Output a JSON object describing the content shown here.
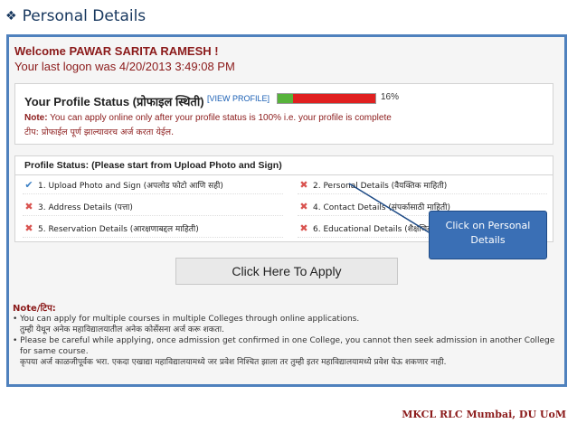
{
  "slide": {
    "title": "Personal Details",
    "bullet_icon": "diamond-bullet-icon"
  },
  "welcome": {
    "greeting": "Welcome PAWAR SARITA RAMESH !",
    "last_logon": "Your last logon was 4/20/2013 3:49:08 PM"
  },
  "profile_status": {
    "title": "Your Profile Status (प्रोफाइल स्थिती)",
    "view_profile_link": "[VIEW PROFILE]",
    "percent_label": "16%",
    "percent_value": 0.16,
    "note_label": "Note:",
    "note_text": "You can apply online only after your profile status is 100% i.e. your profile is complete",
    "note_marathi": "टीप: प्रोफाईल पूर्ण झाल्यावरच अर्ज करता येईल.",
    "colors": {
      "complete": "#57b33b",
      "incomplete": "#e02020"
    }
  },
  "steps": {
    "heading": "Profile Status: (Please start from Upload Photo and Sign)",
    "items": [
      {
        "label": "1. Upload Photo and Sign (अपलोड फोटो आणि सही)",
        "status": "done",
        "icon": "check-icon"
      },
      {
        "label": "2. Personal Details (वैयक्तिक माहिती)",
        "status": "pending",
        "icon": "cross-icon"
      },
      {
        "label": "3. Address Details (पत्ता)",
        "status": "pending",
        "icon": "cross-icon"
      },
      {
        "label": "4. Contact Details (संपर्कासाठी माहिती)",
        "status": "pending",
        "icon": "cross-icon"
      },
      {
        "label": "5. Reservation Details (आरक्षणाबद्दल माहिती)",
        "status": "pending",
        "icon": "cross-icon"
      },
      {
        "label": "6. Educational Details (शैक्षणिक माहिती)",
        "status": "pending",
        "icon": "cross-icon"
      }
    ]
  },
  "apply_button": "Click Here To Apply",
  "callout": {
    "line1": "Click on Personal",
    "line2": "Details"
  },
  "bottom_note": {
    "heading": "Note/टिप:",
    "lines": [
      "• You can apply for multiple courses in multiple Colleges through online applications.",
      "तुम्ही येथून अनेक महाविद्यालयातील अनेक कोर्सेसना अर्ज करू शकता.",
      "• Please be careful while applying, once admission get confirmed in one College, you cannot then seek admission in another College",
      "for same course.",
      "कृपया अर्ज काळजीपूर्वक भरा. एकदा एखाद्या महाविद्यालयामध्ये जर प्रवेश निश्चित झाला तर तुम्ही इतर महाविद्यालयामध्ये प्रवेश घेऊ शकणार नाही."
    ]
  },
  "footer": "MKCL RLC Mumbai, DU UoM"
}
